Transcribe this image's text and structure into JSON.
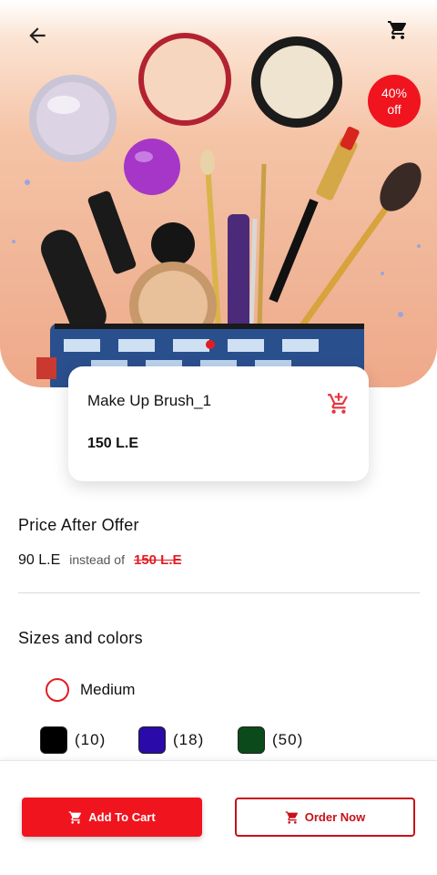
{
  "header": {
    "back_icon": "arrow-left-icon",
    "cart_icon": "shopping-cart-icon"
  },
  "hero": {
    "image_subject": "makeup products and brushes",
    "badge": {
      "line1": "40%",
      "line2": "off",
      "color": "#f0141e"
    }
  },
  "product": {
    "name": "Make Up Brush_1",
    "price": "150 L.E",
    "card_cart_icon": "add-to-cart-icon"
  },
  "offer": {
    "title": "Price After Offer",
    "new_price": "90 L.E",
    "instead_text": "instead of",
    "old_price": "150 L.E"
  },
  "variants": {
    "title": "Sizes and colors",
    "sizes": [
      {
        "label": "Medium",
        "selected": false
      }
    ],
    "colors": [
      {
        "hex": "#000000",
        "qty": "(10)"
      },
      {
        "hex": "#2a0aa8",
        "qty": "(18)"
      },
      {
        "hex": "#0b4a1a",
        "qty": "(50)"
      }
    ]
  },
  "actions": {
    "add_to_cart": "Add To Cart",
    "order_now": "Order Now"
  },
  "colors": {
    "accent": "#f0141e",
    "accent_dark": "#c8101a"
  }
}
